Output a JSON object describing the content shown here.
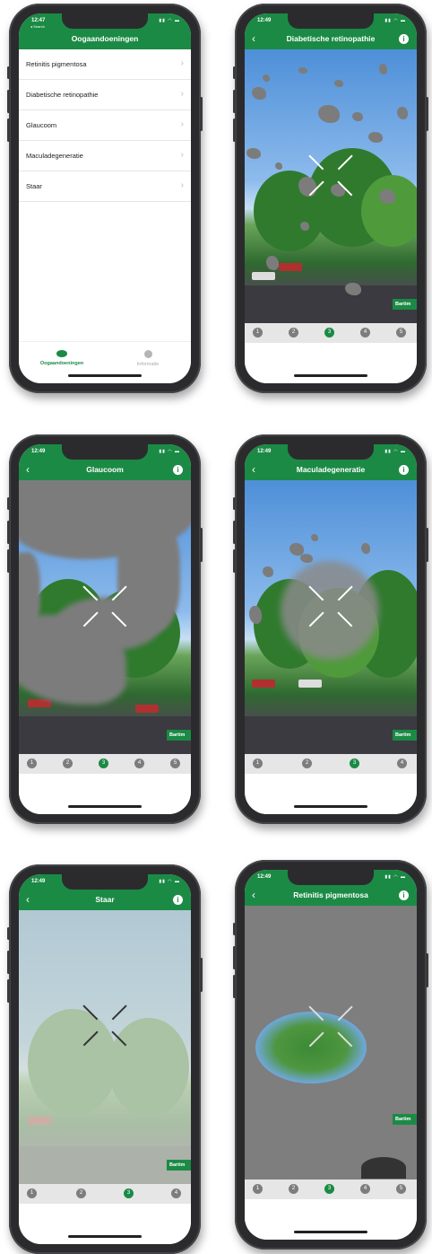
{
  "screen1": {
    "time": "12:47",
    "back_to_app": "◂ Search",
    "title": "Oogaandoeningen",
    "items": [
      {
        "label": "Retinitis pigmentosa"
      },
      {
        "label": "Diabetische retinopathie"
      },
      {
        "label": "Glaucoom"
      },
      {
        "label": "Maculadegeneratie"
      },
      {
        "label": "Staar"
      }
    ],
    "tabs": [
      {
        "label": "Oogaandoeningen",
        "active": true
      },
      {
        "label": "Informatie",
        "active": false
      }
    ]
  },
  "screen2": {
    "time": "12:49",
    "title": "Diabetische retinopathie",
    "badge": "Bartim",
    "steps": [
      "1",
      "2",
      "3",
      "4",
      "5"
    ],
    "active_step": 3
  },
  "screen3": {
    "time": "12:49",
    "title": "Glaucoom",
    "badge": "Bartim",
    "steps": [
      "1",
      "2",
      "3",
      "4",
      "5"
    ],
    "active_step": 3
  },
  "screen4": {
    "time": "12:49",
    "title": "Maculadegeneratie",
    "badge": "Bartim",
    "steps": [
      "1",
      "2",
      "3",
      "4"
    ],
    "active_step": 3
  },
  "screen5": {
    "time": "12:49",
    "title": "Staar",
    "badge": "Bartim",
    "steps": [
      "1",
      "2",
      "3",
      "4"
    ],
    "active_step": 3
  },
  "screen6": {
    "time": "12:49",
    "title": "Retinitis pigmentosa",
    "badge": "Bartim",
    "steps": [
      "1",
      "2",
      "3",
      "4",
      "5"
    ],
    "active_step": 3
  },
  "colors": {
    "brand_green": "#1b8a45",
    "stepper_grey": "#7d7d7d",
    "overlay_grey": "#7c7c7c"
  },
  "icons": {
    "back": "chevron-left-icon",
    "info": "info-icon",
    "list_chevron": "chevron-right-icon",
    "tab_eye": "eye-icon",
    "tab_info": "info-icon"
  }
}
